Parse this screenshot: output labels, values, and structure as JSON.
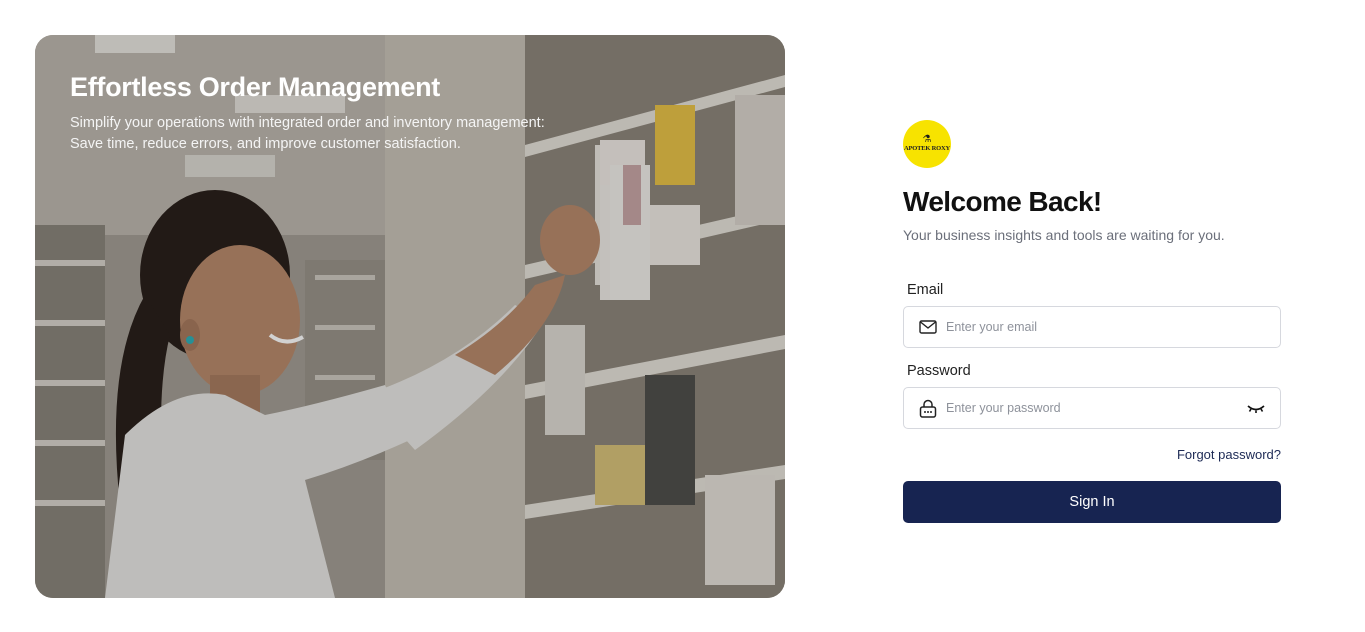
{
  "hero": {
    "title": "Effortless Order Management",
    "subtitle_line1": "Simplify your operations with integrated order and inventory management:",
    "subtitle_line2": "Save time, reduce errors, and improve customer satisfaction."
  },
  "brand": {
    "logo_text": "APOTEK ROXY",
    "logo_color": "#f7e300"
  },
  "login": {
    "title": "Welcome Back!",
    "subtitle": "Your business insights and tools are waiting for you.",
    "email_label": "Email",
    "email_placeholder": "Enter your email",
    "password_label": "Password",
    "password_placeholder": "Enter your password",
    "forgot_label": "Forgot password?",
    "signin_label": "Sign In",
    "accent_color": "#172451"
  },
  "icons": {
    "email": "mail-icon",
    "password": "lock-icon",
    "toggle": "eye-closed-icon"
  }
}
